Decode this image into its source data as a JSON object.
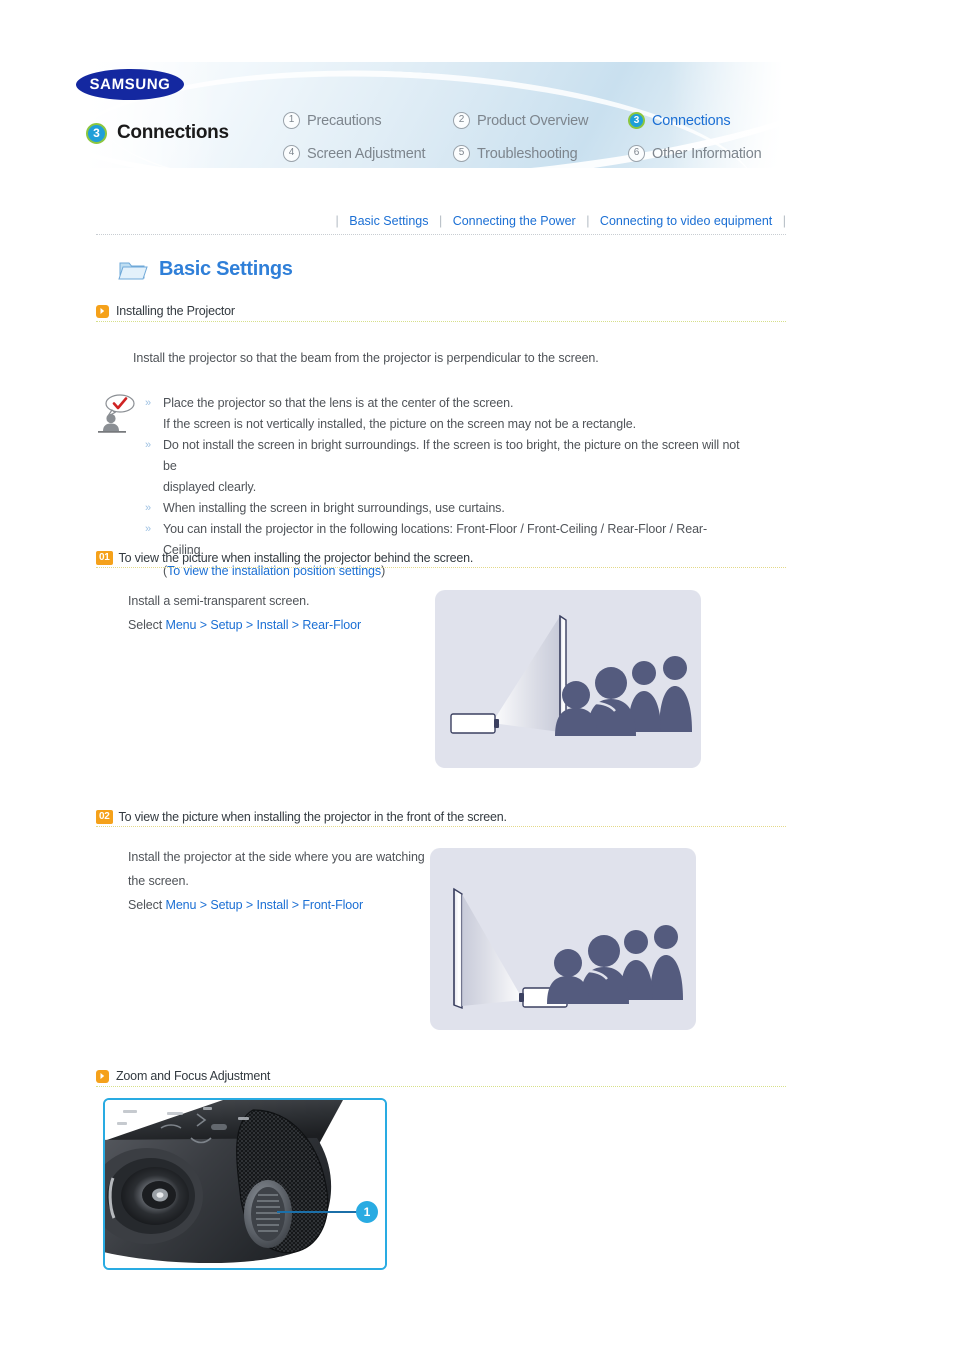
{
  "header": {
    "brand": "SAMSUNG",
    "current_section_number": "3",
    "current_section_label": "Connections",
    "nav_items": [
      {
        "number": "1",
        "label": "Precautions",
        "active": false
      },
      {
        "number": "2",
        "label": "Product Overview",
        "active": false
      },
      {
        "number": "3",
        "label": "Connections",
        "active": true
      },
      {
        "number": "4",
        "label": "Screen Adjustment",
        "active": false
      },
      {
        "number": "5",
        "label": "Troubleshooting",
        "active": false
      },
      {
        "number": "6",
        "label": "Other Information",
        "active": false
      }
    ]
  },
  "toplinks": {
    "separator": "|",
    "items": [
      "Basic Settings",
      "Connecting the Power",
      "Connecting to video equipment"
    ]
  },
  "page": {
    "title": "Basic Settings",
    "folder_icon": "folder-icon"
  },
  "section_installing": {
    "heading": "Installing the Projector",
    "intro": "Install the projector so that the beam from the projector is perpendicular to the screen.",
    "tips": [
      {
        "bullet": true,
        "text": "Place the projector so that the lens is at the center of the screen."
      },
      {
        "bullet": false,
        "text": "If the screen is not vertically installed, the picture on the screen may not be a rectangle."
      },
      {
        "bullet": true,
        "text": "Do not install the screen in bright surroundings. If the screen is too bright, the picture on the screen will not be"
      },
      {
        "bullet": false,
        "text": "displayed clearly."
      },
      {
        "bullet": true,
        "text": "When installing the screen in bright surroundings, use curtains."
      },
      {
        "bullet": true,
        "text": "You can install the projector in the following locations: Front-Floor / Front-Ceiling / Rear-Floor / Rear-Ceiling."
      }
    ],
    "tip_link_prefix": "(",
    "tip_link": "To view the installation position settings",
    "tip_link_suffix": ")"
  },
  "step01": {
    "number": "01",
    "heading": "To view the picture when installing the projector behind the screen.",
    "line1": "Install a semi-transparent screen.",
    "line2_prefix": "Select ",
    "line2_path": "Menu > Setup > Install > Rear-Floor",
    "illustration": "rear-projection-diagram"
  },
  "step02": {
    "number": "02",
    "heading": "To view the picture when installing the projector in the front of the screen.",
    "line1": "Install the projector at the side where you are watching",
    "line2": "the screen.",
    "line3_prefix": "Select ",
    "line3_path": "Menu > Setup > Install > Front-Floor",
    "illustration": "front-projection-diagram"
  },
  "section_zoom": {
    "heading": "Zoom and Focus Adjustment",
    "photo_alt": "projector-lens-photo",
    "callout": "1"
  },
  "colors": {
    "link_blue": "#1b6fd4",
    "title_blue": "#2f7fd8",
    "accent_orange": "#f5a11a",
    "accent_cyan": "#29abe2",
    "badge_green": "#8cc63f",
    "samsung_blue": "#1428a0",
    "illustration_bg": "#e0e2ec",
    "silhouette": "#545b7e"
  }
}
